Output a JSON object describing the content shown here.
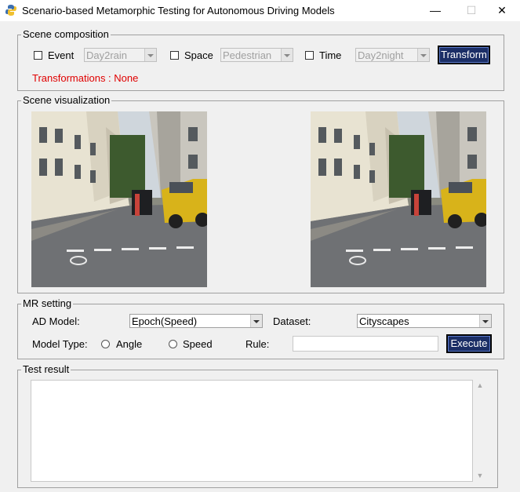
{
  "window": {
    "title": "Scenario-based Metamorphic Testing for Autonomous Driving Models",
    "minimize_glyph": "—",
    "maximize_glyph": "☐",
    "close_glyph": "✕"
  },
  "scene_composition": {
    "legend": "Scene composition",
    "event": {
      "label": "Event",
      "checked": false,
      "value": "Day2rain"
    },
    "space": {
      "label": "Space",
      "checked": false,
      "value": "Pedestrian"
    },
    "time": {
      "label": "Time",
      "checked": false,
      "value": "Day2night"
    },
    "transform_label": "Transform",
    "transformations_text": "Transformations : None"
  },
  "scene_visualization": {
    "legend": "Scene visualization",
    "images": [
      "street-scene-original",
      "street-scene-transformed"
    ]
  },
  "mr_setting": {
    "legend": "MR setting",
    "ad_model_label": "AD Model:",
    "ad_model_value": "Epoch(Speed)",
    "dataset_label": "Dataset:",
    "dataset_value": "Cityscapes",
    "model_type_label": "Model Type:",
    "option_angle": "Angle",
    "option_speed": "Speed",
    "rule_label": "Rule:",
    "rule_value": "",
    "execute_label": "Execute"
  },
  "test_result": {
    "legend": "Test result",
    "content": ""
  },
  "colors": {
    "accent_button": "#1b2e66",
    "error_text": "#e00000",
    "window_bg": "#f0f0f0"
  }
}
